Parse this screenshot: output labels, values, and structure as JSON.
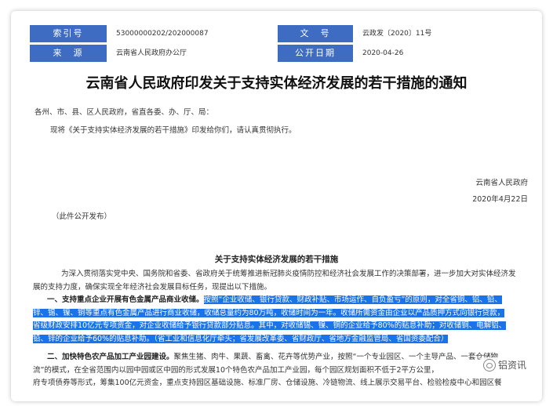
{
  "meta": {
    "index_label": "索引号",
    "index_value": "53000000202/202000087",
    "doc_no_label": "文　号",
    "doc_no_value": "云政发〔2020〕11号",
    "source_label": "来　源",
    "source_value": "云南省人民政府办公厅",
    "date_label": "公开日期",
    "date_value": "2020-04-26"
  },
  "title": "云南省人民政府印发关于支持实体经济发展的若干措施的通知",
  "recipients": "各州、市、县、区人民政府，省直各委、办、厅、局：",
  "notice": "现将《关于支持实体经济发展的若干措施》印发给你们，请认真贯彻执行。",
  "issuer": "云南省人民政府",
  "issue_date": "2020年4月22日",
  "publish_note": "（此件公开发布）",
  "section_title": "关于支持实体经济发展的若干措施",
  "intro_line1": "为深入贯彻落实党中央、国务院和省委、省政府关于统筹推进新冠肺炎疫情防控和经济社会发展工作的决策部署，进一步加大对实体经济发",
  "intro_line2": "展的支持力度，确保实现全年经济社会发展目标任务，现提出以下措施。",
  "item1_title": "一、支持重点企业开展有色金属产品商业收储。",
  "item1_line1": "按照“企业收储、银行贷款、财政补贴、市场运作、自负盈亏”的原则，对全省铜、铝、铅、",
  "item1_line2": "锌、锡、镍、铜等重点有色金属产品进行商业收储，收储总量约为80万吨，收储时间为一年。收储所需资金由企业以产品质押方式向银行贷款，",
  "item1_line3": "省级财政安排10亿元专项资金，对企业收储给予银行贷款部分贴息。其中，对收储锡、镍、铜的企业给予80%的贴息补助；对收储铜、电解铝、",
  "item1_line4": "铅、锌的企业给予60%的贴息补助。（省工业和信息化厅牵头；省发展改革委、省财政厅、省地方金融监管局、省国资委配合）",
  "item2_title": "二、加快特色农产品加工产业园建设。",
  "item2_line1": "聚焦生猪、肉牛、果蔬、畜禽、花卉等优势产业，按照“一个专业园区、一个主导产品、一套仓储物",
  "item2_line2": "流”的模式，在全省范围内以园中园或区中园的形式发展10个特色农产品加工产业园，每个园区规划面积不低于2平方公里，",
  "item2_line3": "府专项债券等形式，筹集100亿元资金，重点支持园区基础设施、标准厂房、仓储设施、冷链物流、线上展示交易平台、检验检疫中心和园区餐",
  "watermark": "铝资讯"
}
